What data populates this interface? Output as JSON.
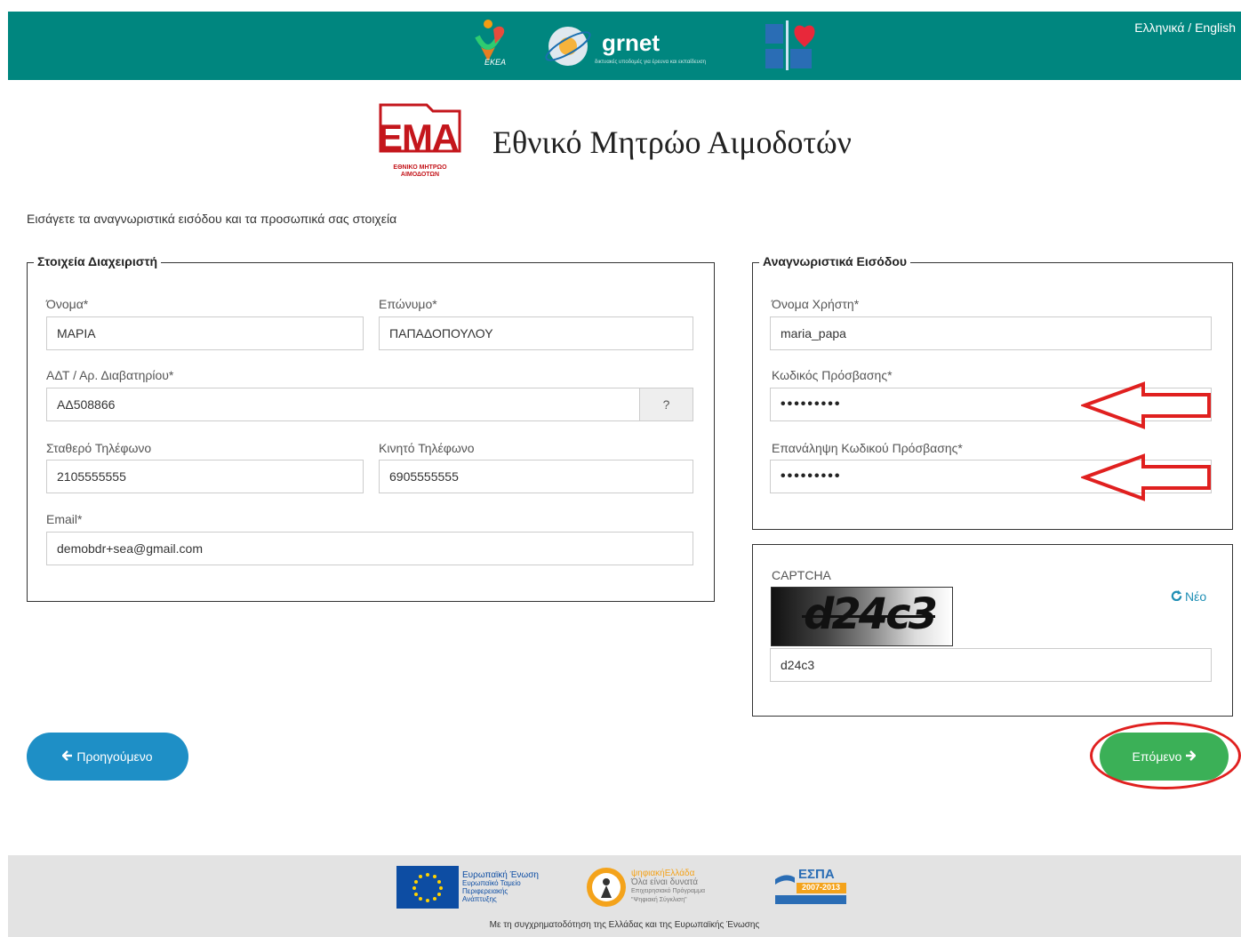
{
  "header": {
    "language_switch": "Ελληνικά / English",
    "logos": {
      "ekea": "ΕΚΕΑ",
      "grnet": "grnet",
      "grnet_tagline": "δικτυακές υποδομές για έρευνα και εκπαίδευση"
    },
    "colors": {
      "bar": "#00867f"
    }
  },
  "brand": {
    "logo_text": "ΕΜΑ",
    "logo_subtext": "ΕΘΝΙΚΟ ΜΗΤΡΩΟ ΑΙΜΟΔΟΤΩΝ",
    "title": "Εθνικό Μητρώο Αιμοδοτών"
  },
  "intro": "Εισάγετε τα αναγνωριστικά εισόδου και τα προσωπικά σας στοιχεία",
  "admin": {
    "legend": "Στοιχεία Διαχειριστή",
    "first_name": {
      "label": "Όνομα*",
      "value": "ΜΑΡΙΑ"
    },
    "last_name": {
      "label": "Επώνυμο*",
      "value": "ΠΑΠΑΔΟΠΟΥΛΟΥ"
    },
    "id_number": {
      "label": "ΑΔΤ / Αρ. Διαβατηρίου*",
      "value": "ΑΔ508866",
      "help": "?"
    },
    "landline": {
      "label": "Σταθερό Τηλέφωνο",
      "value": "2105555555"
    },
    "mobile": {
      "label": "Κινητό Τηλέφωνο",
      "value": "6905555555"
    },
    "email": {
      "label": "Email*",
      "value": "demobdr+sea@gmail.com"
    }
  },
  "credentials": {
    "legend": "Αναγνωριστικά Εισόδου",
    "username": {
      "label": "Όνομα Χρήστη*",
      "value": "maria_papa"
    },
    "password": {
      "label": "Κωδικός Πρόσβασης*",
      "value": "•••••••••"
    },
    "password_repeat": {
      "label": "Επανάληψη Κωδικού Πρόσβασης*",
      "value": "•••••••••"
    }
  },
  "captcha": {
    "label": "CAPTCHA",
    "image_text": "d24c3",
    "refresh_label": "Νέο",
    "value": "d24c3"
  },
  "nav": {
    "prev_label": "Προηγούμενο",
    "next_label": "Επόμενο",
    "colors": {
      "prev": "#1e8fc6",
      "next": "#3bb057"
    }
  },
  "annotations": {
    "color": "#e0201f"
  },
  "footer": {
    "eu_text": [
      "Ευρωπαϊκή Ένωση",
      "Ευρωπαϊκό Ταμείο",
      "Περιφερειακής",
      "Ανάπτυξης"
    ],
    "digital_text": [
      "ψηφιακήΕλλάδα",
      "Όλα είναι δυνατά",
      "Επιχειρησιακό Πρόγραμμα",
      "\"Ψηφιακή Σύγκλιση\""
    ],
    "espa": "ΕΣΠΑ",
    "espa_years": "2007-2013",
    "note": "Με τη συγχρηματοδότηση της Ελλάδας και της Ευρωπαϊκής Ένωσης"
  }
}
